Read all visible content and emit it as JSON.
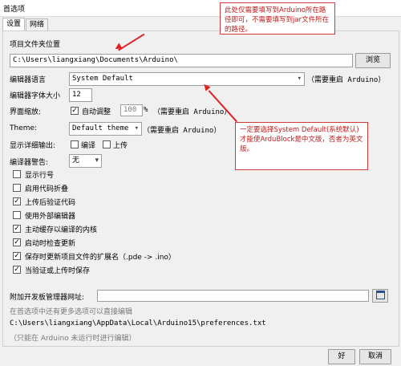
{
  "window": {
    "title": "首选项"
  },
  "tabs": [
    {
      "label": "设置",
      "active": true
    },
    {
      "label": "网络",
      "active": false
    }
  ],
  "sketchbook": {
    "label": "项目文件夹位置",
    "value": "C:\\Users\\liangxiang\\Documents\\Arduino\\",
    "browse_label": "浏览"
  },
  "language": {
    "label": "编辑器语言",
    "value": "System Default",
    "restart_note": "（需要重启 Arduino）"
  },
  "font_size": {
    "label": "编辑器字体大小",
    "value": "12"
  },
  "scale": {
    "label": "界面缩放:",
    "auto_label": "自动调整",
    "auto_checked": true,
    "value": "100",
    "unit": "%",
    "restart_note": "（需要重启 Arduino）"
  },
  "theme": {
    "label": "Theme:",
    "value": "Default theme",
    "restart_note": "（需要重启 Arduino）"
  },
  "verbose": {
    "label": "显示详细输出:",
    "compile_label": "编译",
    "compile_checked": false,
    "upload_label": "上传",
    "upload_checked": false
  },
  "warnings": {
    "label": "编译器警告:",
    "value": "无"
  },
  "options": [
    {
      "label": "显示行号",
      "checked": false
    },
    {
      "label": "启用代码折叠",
      "checked": false
    },
    {
      "label": "上传后验证代码",
      "checked": true
    },
    {
      "label": "使用外部编辑器",
      "checked": false
    },
    {
      "label": "主动缓存以编译的内核",
      "checked": true
    },
    {
      "label": "启动时检查更新",
      "checked": true
    },
    {
      "label": "保存时更新项目文件的扩展名（.pde -> .ino）",
      "checked": true
    },
    {
      "label": "当验证或上传时保存",
      "checked": true
    }
  ],
  "board_manager": {
    "label": "附加开发板管理器网址:",
    "value": ""
  },
  "more_prefs": "在首选项中还有更多选项可以直接编辑",
  "prefs_path": "C:\\Users\\liangxiang\\AppData\\Local\\Arduino15\\preferences.txt",
  "prefs_hint": "（只能在 Arduino 未运行时进行编辑）",
  "buttons": {
    "ok": "好",
    "cancel": "取消"
  },
  "annotations": {
    "path_note": "此处仅需要填写到Arduino所在路径即可，不需要填写到jar文件所在的路径。",
    "language_note": "一定要选择System Default(系统默认)才能使ArduBlock是中文版，否者为英文版。"
  },
  "colors": {
    "annotation": "#d22222",
    "panel": "#f0f0f0"
  }
}
